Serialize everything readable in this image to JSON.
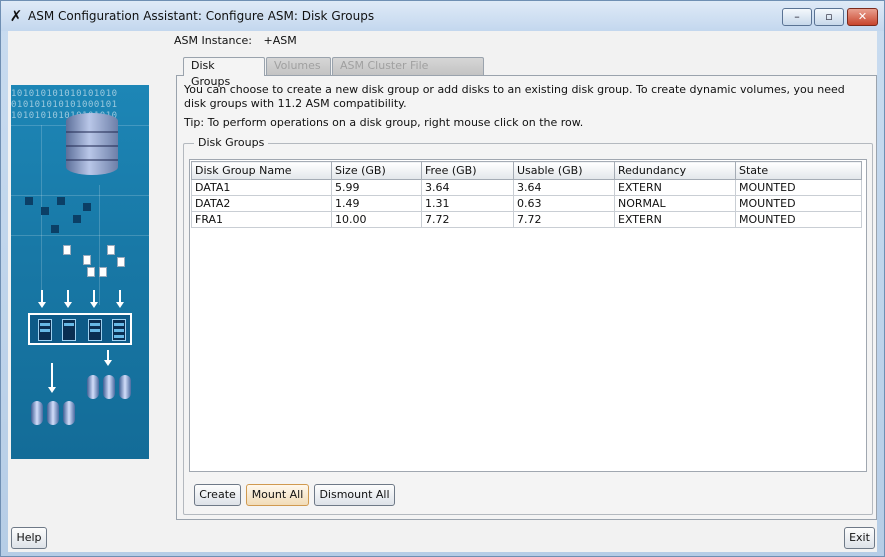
{
  "window": {
    "title": "ASM Configuration Assistant: Configure ASM: Disk Groups",
    "minimize": "–",
    "maximize": "▫",
    "close": "✕"
  },
  "asm_instance": {
    "label": "ASM Instance:",
    "value": "+ASM"
  },
  "tabs": [
    {
      "label": "Disk Groups",
      "state": "active"
    },
    {
      "label": "Volumes",
      "state": "disabled"
    },
    {
      "label": "ASM Cluster File Systems",
      "state": "disabled"
    }
  ],
  "description": "You can choose to create a new disk group or add disks to an existing disk group. To create dynamic volumes, you need disk groups with 11.2 ASM compatibility.",
  "tip": "Tip: To perform operations on a disk group, right mouse click on the row.",
  "disk_groups": {
    "title": "Disk Groups",
    "columns": [
      "Disk Group Name",
      "Size (GB)",
      "Free (GB)",
      "Usable (GB)",
      "Redundancy",
      "State"
    ],
    "rows": [
      [
        "DATA1",
        "5.99",
        "3.64",
        "3.64",
        "EXTERN",
        "MOUNTED"
      ],
      [
        "DATA2",
        "1.49",
        "1.31",
        "0.63",
        "NORMAL",
        "MOUNTED"
      ],
      [
        "FRA1",
        "10.00",
        "7.72",
        "7.72",
        "EXTERN",
        "MOUNTED"
      ]
    ],
    "buttons": {
      "create": "Create",
      "mount_all": "Mount All",
      "dismount_all": "Dismount All"
    }
  },
  "footer": {
    "help": "Help",
    "exit": "Exit"
  },
  "art_binary": [
    "101010101010101010",
    "010101010101000101",
    "101010101010101010"
  ],
  "colors": {
    "art_blue": "#1878a6",
    "focus_button": "#f1dcb8"
  }
}
